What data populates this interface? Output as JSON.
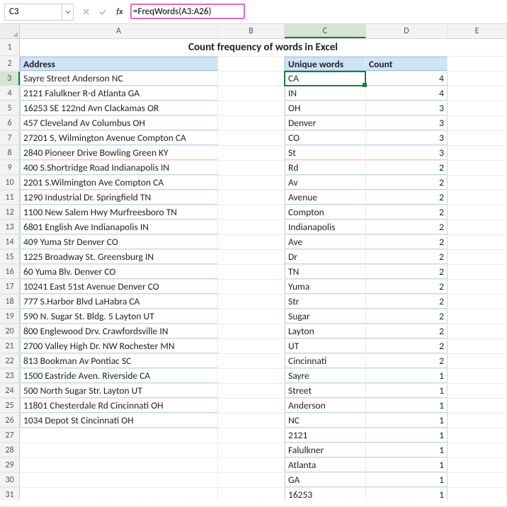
{
  "formula_bar": {
    "name_box": "C3",
    "formula": "=FreqWords(A3:A26)"
  },
  "col_headers": [
    "A",
    "B",
    "C",
    "D",
    "E"
  ],
  "title": "Count frequency of words in Excel",
  "table_headers": {
    "address": "Address",
    "words": "Unique words",
    "count": "Count"
  },
  "addresses": [
    "Sayre Street  Anderson  NC",
    "2121 Falulkner R-d  Atlanta  GA",
    "16253 SE 122nd Avn  Clackamas  OR",
    "457 Cleveland Av  Columbus  OH",
    "27201 S, Wilmington Avenue  Compton  CA",
    "2840 Pioneer Drive  Bowling Green  KY",
    "400 S.Shortridge Road  Indianapolis  IN",
    "2201 S.Wilmington Ave  Compton  CA",
    "1290 Industrial Dr.  Springfield  TN",
    "1100 New Salem Hwy  Murfreesboro  TN",
    "6801 English Ave  Indianapolis  IN",
    "409 Yuma Str  Denver  CO",
    "1225  Broadway St.  Greensburg  IN",
    "60 Yuma Blv.  Denver  CO",
    "10241 East 51st Avenue  Denver  CO",
    "777 S.Harbor Blvd  LaHabra  CA",
    "590 N. Sugar St. Bldg. 5  Layton  UT",
    "800 Englewood Drv.  Crawfordsville  IN",
    "2700 Valley High Dr. NW  Rochester  MN",
    "813 Bookman Av  Pontiac  SC",
    "1500 Eastride Aven.  Riverside  CA",
    "500 North Sugar Str.  Layton  UT",
    "11801 Chesterdale Rd  Cincinnati  OH",
    "1034 Depot St  Cincinnati  OH"
  ],
  "freq": [
    {
      "word": "CA",
      "count": 4
    },
    {
      "word": "IN",
      "count": 4
    },
    {
      "word": "OH",
      "count": 3
    },
    {
      "word": "Denver",
      "count": 3
    },
    {
      "word": "CO",
      "count": 3
    },
    {
      "word": "St",
      "count": 3
    },
    {
      "word": "Rd",
      "count": 2
    },
    {
      "word": "Av",
      "count": 2
    },
    {
      "word": "Avenue",
      "count": 2
    },
    {
      "word": "Compton",
      "count": 2
    },
    {
      "word": "Indianapolis",
      "count": 2
    },
    {
      "word": "Ave",
      "count": 2
    },
    {
      "word": "Dr",
      "count": 2
    },
    {
      "word": "TN",
      "count": 2
    },
    {
      "word": "Yuma",
      "count": 2
    },
    {
      "word": "Str",
      "count": 2
    },
    {
      "word": "Sugar",
      "count": 2
    },
    {
      "word": "Layton",
      "count": 2
    },
    {
      "word": "UT",
      "count": 2
    },
    {
      "word": "Cincinnati",
      "count": 2
    },
    {
      "word": "Sayre",
      "count": 1
    },
    {
      "word": "Street",
      "count": 1
    },
    {
      "word": "Anderson",
      "count": 1
    },
    {
      "word": "NC",
      "count": 1
    },
    {
      "word": "2121",
      "count": 1
    },
    {
      "word": "Falulkner",
      "count": 1
    },
    {
      "word": "Atlanta",
      "count": 1
    },
    {
      "word": "GA",
      "count": 1
    },
    {
      "word": "16253",
      "count": 1
    }
  ],
  "chart_data": {
    "type": "table",
    "title": "Count frequency of words in Excel",
    "columns": [
      "Unique words",
      "Count"
    ],
    "rows": [
      [
        "CA",
        4
      ],
      [
        "IN",
        4
      ],
      [
        "OH",
        3
      ],
      [
        "Denver",
        3
      ],
      [
        "CO",
        3
      ],
      [
        "St",
        3
      ],
      [
        "Rd",
        2
      ],
      [
        "Av",
        2
      ],
      [
        "Avenue",
        2
      ],
      [
        "Compton",
        2
      ],
      [
        "Indianapolis",
        2
      ],
      [
        "Ave",
        2
      ],
      [
        "Dr",
        2
      ],
      [
        "TN",
        2
      ],
      [
        "Yuma",
        2
      ],
      [
        "Str",
        2
      ],
      [
        "Sugar",
        2
      ],
      [
        "Layton",
        2
      ],
      [
        "UT",
        2
      ],
      [
        "Cincinnati",
        2
      ],
      [
        "Sayre",
        1
      ],
      [
        "Street",
        1
      ],
      [
        "Anderson",
        1
      ],
      [
        "NC",
        1
      ],
      [
        "2121",
        1
      ],
      [
        "Falulkner",
        1
      ],
      [
        "Atlanta",
        1
      ],
      [
        "GA",
        1
      ],
      [
        "16253",
        1
      ]
    ]
  }
}
